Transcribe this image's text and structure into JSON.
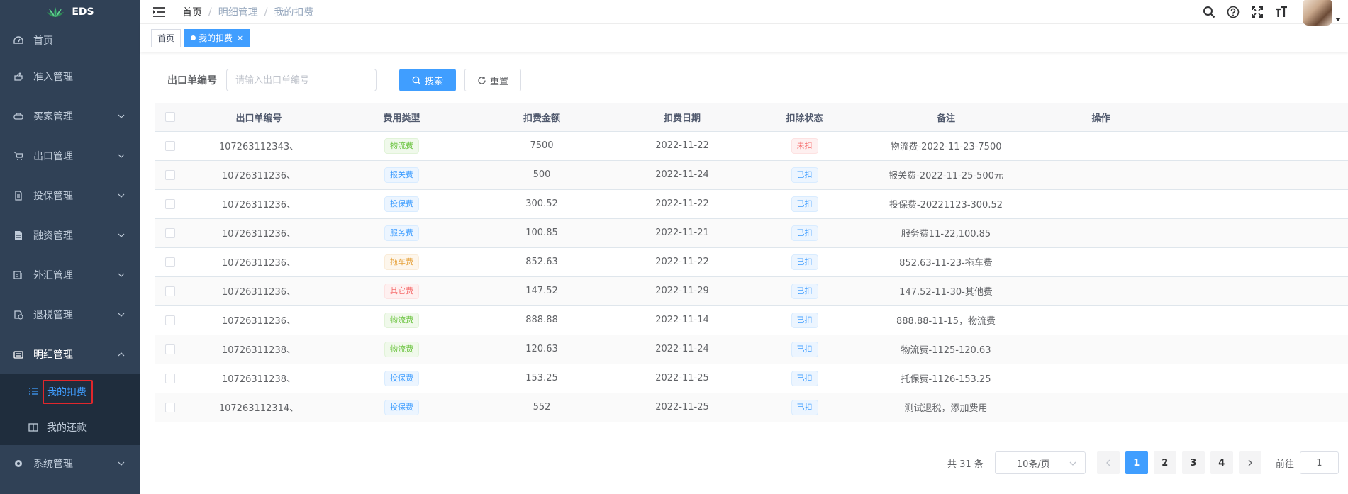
{
  "app": {
    "logo_text": "EDS"
  },
  "sidebar": {
    "items": [
      {
        "label": "首页",
        "icon": "dashboard-icon"
      },
      {
        "label": "准入管理",
        "icon": "hand-icon"
      },
      {
        "label": "买家管理",
        "icon": "shopping-bag-icon"
      },
      {
        "label": "出口管理",
        "icon": "cart-icon"
      },
      {
        "label": "投保管理",
        "icon": "document-icon"
      },
      {
        "label": "融资管理",
        "icon": "file-icon"
      },
      {
        "label": "外汇管理",
        "icon": "exchange-icon"
      },
      {
        "label": "退税管理",
        "icon": "refund-icon"
      },
      {
        "label": "明细管理",
        "icon": "detail-icon"
      },
      {
        "label": "系统管理",
        "icon": "settings-icon"
      }
    ],
    "sub_items": [
      {
        "label": "我的扣费",
        "icon": "list-icon"
      },
      {
        "label": "我的还款",
        "icon": "columns-icon"
      }
    ]
  },
  "breadcrumb": [
    "首页",
    "明细管理",
    "我的扣费"
  ],
  "tags": [
    {
      "label": "首页"
    },
    {
      "label": "我的扣费"
    }
  ],
  "search": {
    "label": "出口单编号",
    "placeholder": "请输入出口单编号",
    "search_button": "搜索",
    "reset_button": "重置"
  },
  "table": {
    "columns": [
      "出口单编号",
      "费用类型",
      "扣费金额",
      "扣费日期",
      "扣除状态",
      "备注",
      "操作"
    ],
    "rows": [
      {
        "order_no": "107263112343、",
        "fee_type": "物流费",
        "fee_color": "green",
        "amount": "7500",
        "date": "2022-11-22",
        "status": "未扣",
        "status_color": "red",
        "remark": "物流费-2022-11-23-7500"
      },
      {
        "order_no": "10726311236、",
        "fee_type": "报关费",
        "fee_color": "blue",
        "amount": "500",
        "date": "2022-11-24",
        "status": "已扣",
        "status_color": "blue",
        "remark": "报关费-2022-11-25-500元"
      },
      {
        "order_no": "10726311236、",
        "fee_type": "投保费",
        "fee_color": "blue",
        "amount": "300.52",
        "date": "2022-11-22",
        "status": "已扣",
        "status_color": "blue",
        "remark": "投保费-20221123-300.52"
      },
      {
        "order_no": "10726311236、",
        "fee_type": "服务费",
        "fee_color": "blue",
        "amount": "100.85",
        "date": "2022-11-21",
        "status": "已扣",
        "status_color": "blue",
        "remark": "服务费11-22,100.85"
      },
      {
        "order_no": "10726311236、",
        "fee_type": "拖车费",
        "fee_color": "orange",
        "amount": "852.63",
        "date": "2022-11-22",
        "status": "已扣",
        "status_color": "blue",
        "remark": "852.63-11-23-拖车费"
      },
      {
        "order_no": "10726311236、",
        "fee_type": "其它费",
        "fee_color": "red",
        "amount": "147.52",
        "date": "2022-11-29",
        "status": "已扣",
        "status_color": "blue",
        "remark": "147.52-11-30-其他费"
      },
      {
        "order_no": "10726311236、",
        "fee_type": "物流费",
        "fee_color": "green",
        "amount": "888.88",
        "date": "2022-11-14",
        "status": "已扣",
        "status_color": "blue",
        "remark": "888.88-11-15，物流费"
      },
      {
        "order_no": "10726311238、",
        "fee_type": "物流费",
        "fee_color": "green",
        "amount": "120.63",
        "date": "2022-11-24",
        "status": "已扣",
        "status_color": "blue",
        "remark": "物流费-1125-120.63"
      },
      {
        "order_no": "10726311238、",
        "fee_type": "投保费",
        "fee_color": "blue",
        "amount": "153.25",
        "date": "2022-11-25",
        "status": "已扣",
        "status_color": "blue",
        "remark": "托保费-1126-153.25"
      },
      {
        "order_no": "107263112314、",
        "fee_type": "投保费",
        "fee_color": "blue",
        "amount": "552",
        "date": "2022-11-25",
        "status": "已扣",
        "status_color": "blue",
        "remark": "测试退税，添加费用"
      }
    ]
  },
  "pagination": {
    "total_text": "共 31 条",
    "page_size": "10条/页",
    "pages": [
      "1",
      "2",
      "3",
      "4"
    ],
    "current_page": "1",
    "jump_label": "前往",
    "jump_value": "1"
  }
}
